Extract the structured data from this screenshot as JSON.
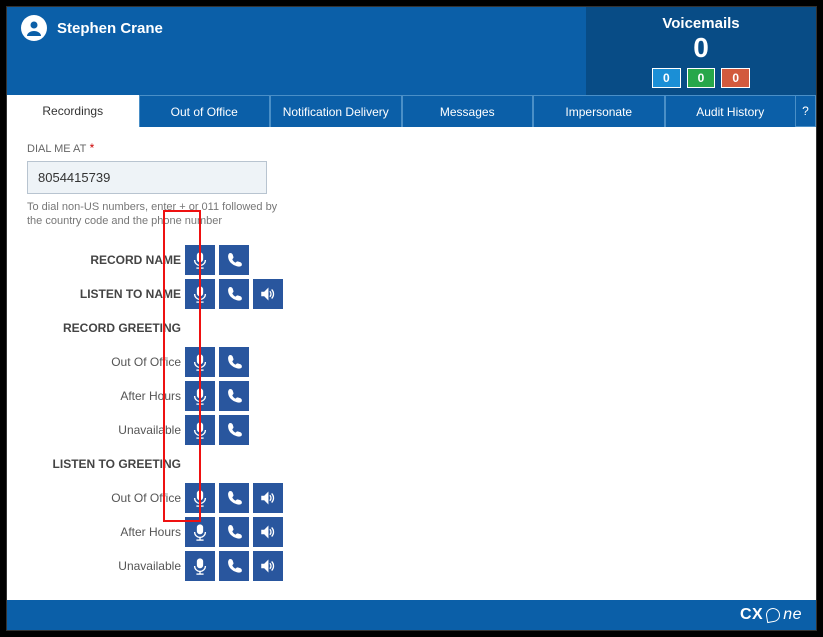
{
  "header": {
    "username": "Stephen Crane",
    "voicemail_label": "Voicemails",
    "voicemail_count": "0",
    "badges": {
      "blue": "0",
      "green": "0",
      "red": "0"
    }
  },
  "tabs": {
    "recordings": "Recordings",
    "out_of_office": "Out of Office",
    "notification": "Notification Delivery",
    "messages": "Messages",
    "impersonate": "Impersonate",
    "audit": "Audit History"
  },
  "help": "?",
  "content": {
    "dial_label": "DIAL ME AT",
    "required": "*",
    "phone_value": "8054415739",
    "hint": "To dial non-US numbers, enter + or 011 followed by the country code and the phone number",
    "record_name": "RECORD NAME",
    "listen_name": "LISTEN TO NAME",
    "record_greeting": "RECORD GREETING",
    "listen_greeting": "LISTEN TO GREETING",
    "out_of_office": "Out Of Office",
    "after_hours": "After Hours",
    "unavailable": "Unavailable"
  },
  "footer": {
    "brand_cx": "CX",
    "brand_ne": "ne"
  }
}
